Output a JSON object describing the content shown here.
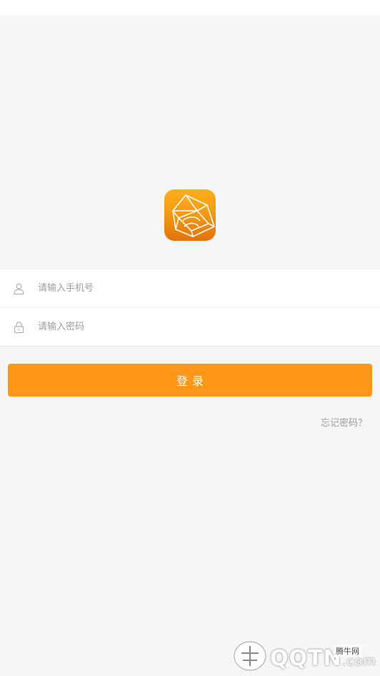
{
  "login": {
    "phone_placeholder": "请输入手机号",
    "password_placeholder": "请输入密码",
    "submit_label": "登录",
    "forgot_label": "忘记密码？"
  },
  "icons": {
    "app_logo": "polyhedron-logo-icon",
    "phone_field": "user-icon",
    "password_field": "lock-icon"
  },
  "colors": {
    "accent": "#ff9617",
    "logo_top": "#ffae1a",
    "logo_bottom": "#e2730c",
    "background": "#f6f6f6",
    "placeholder": "#9d9d9d"
  },
  "watermark": {
    "brand": "QQTN",
    "domain": ".com",
    "badge": "腾牛网"
  }
}
